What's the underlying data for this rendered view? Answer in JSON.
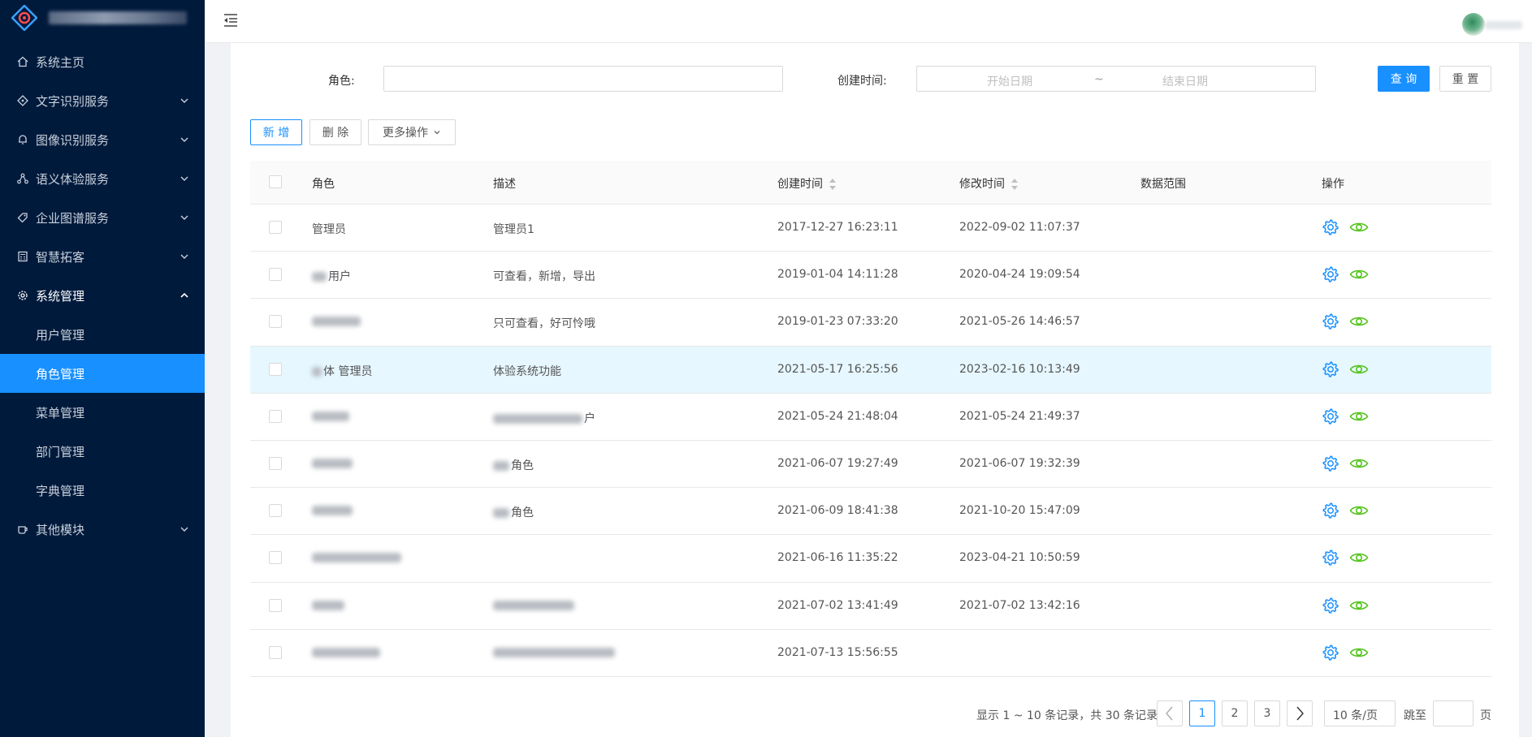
{
  "sidebar": {
    "items": [
      {
        "label": "系统主页",
        "icon": "home-icon"
      },
      {
        "label": "文字识别服务",
        "icon": "diamond-icon"
      },
      {
        "label": "图像识别服务",
        "icon": "bell-icon"
      },
      {
        "label": "语义体验服务",
        "icon": "nodes-icon"
      },
      {
        "label": "企业图谱服务",
        "icon": "tag-icon"
      },
      {
        "label": "智慧拓客",
        "icon": "calculator-icon"
      },
      {
        "label": "系统管理",
        "icon": "gear-icon"
      },
      {
        "label": "其他模块",
        "icon": "cup-icon"
      }
    ],
    "sub_items": [
      {
        "label": "用户管理"
      },
      {
        "label": "角色管理"
      },
      {
        "label": "菜单管理"
      },
      {
        "label": "部门管理"
      },
      {
        "label": "字典管理"
      }
    ]
  },
  "filter": {
    "role_label": "角色:",
    "role_value": "",
    "created_label": "创建时间:",
    "start_placeholder": "开始日期",
    "range_sep": "~",
    "end_placeholder": "结束日期",
    "query_label": "查 询",
    "reset_label": "重 置"
  },
  "toolbar": {
    "add_label": "新 增",
    "delete_label": "删 除",
    "more_label": "更多操作"
  },
  "table": {
    "headers": {
      "role": "角色",
      "desc": "描述",
      "created": "创建时间",
      "modified": "修改时间",
      "scope": "数据范围",
      "actions": "操作"
    },
    "rows": [
      {
        "role": "管理员",
        "desc": "管理员1",
        "created": "2017-12-27 16:23:11",
        "modified": "2022-09-02 11:07:37"
      },
      {
        "role": "用户",
        "desc": "可查看，新增，导出",
        "created": "2019-01-04 14:11:28",
        "modified": "2020-04-24 19:09:54"
      },
      {
        "role": "",
        "desc": "只可查看，好可怜哦",
        "created": "2019-01-23 07:33:20",
        "modified": "2021-05-26 14:46:57"
      },
      {
        "role": "体 管理员",
        "desc": "体验系统功能",
        "created": "2021-05-17 16:25:56",
        "modified": "2023-02-16 10:13:49"
      },
      {
        "role": "",
        "desc": "户",
        "created": "2021-05-24 21:48:04",
        "modified": "2021-05-24 21:49:37"
      },
      {
        "role": "",
        "desc": "角色",
        "created": "2021-06-07 19:27:49",
        "modified": "2021-06-07 19:32:39"
      },
      {
        "role": "",
        "desc": "角色",
        "created": "2021-06-09 18:41:38",
        "modified": "2021-10-20 15:47:09"
      },
      {
        "role": "",
        "desc": "",
        "created": "2021-06-16 11:35:22",
        "modified": "2023-04-21 10:50:59"
      },
      {
        "role": "",
        "desc": "",
        "created": "2021-07-02 13:41:49",
        "modified": "2021-07-02 13:42:16"
      },
      {
        "role": "",
        "desc": "",
        "created": "2021-07-13 15:56:55",
        "modified": ""
      }
    ]
  },
  "pagination": {
    "info": "显示 1 ~ 10 条记录，共 30 条记录",
    "pages": [
      "1",
      "2",
      "3"
    ],
    "current": "1",
    "page_size": "10 条/页",
    "jump_label": "跳至",
    "page_label": "页"
  },
  "colors": {
    "sidebar_bg": "#001a3c",
    "accent": "#1890ff",
    "view_icon": "#52c41a"
  }
}
